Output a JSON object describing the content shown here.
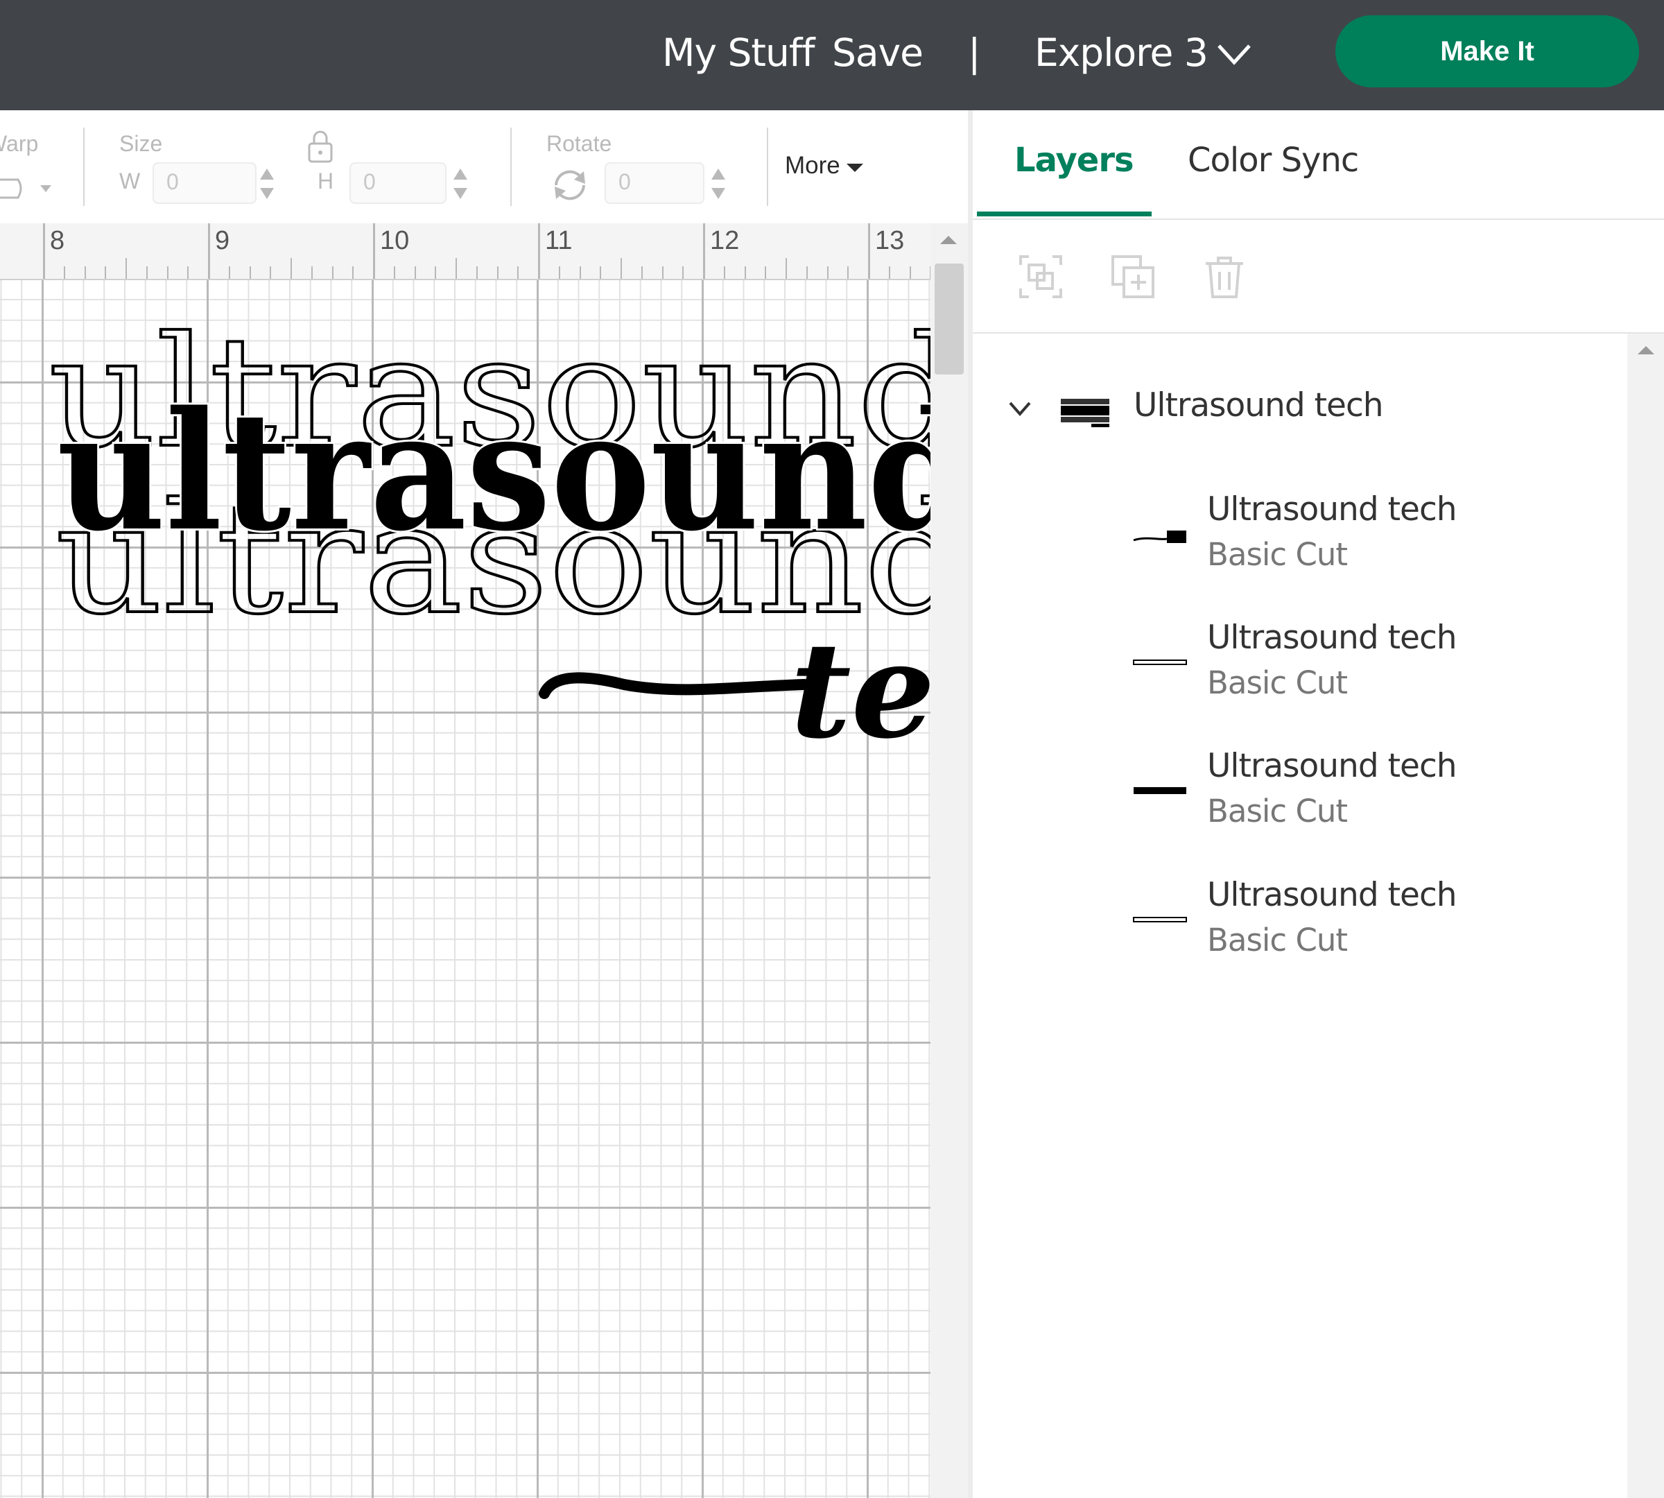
{
  "header": {
    "my_stuff": "My Stuff",
    "save": "Save",
    "separator": "|",
    "machine": "Explore 3",
    "make_it": "Make It",
    "background": "#414549",
    "accent": "#007f5b"
  },
  "toolbar": {
    "warp_label": "Warp",
    "size_label": "Size",
    "width_prefix": "W",
    "width_value": "0",
    "height_prefix": "H",
    "height_value": "0",
    "rotate_label": "Rotate",
    "rotate_value": "0",
    "more_label": "More",
    "icons": [
      "warp-icon",
      "lock-icon",
      "rotate-icon"
    ]
  },
  "ruler": {
    "ticks": [
      "8",
      "9",
      "10",
      "11",
      "12",
      "13"
    ]
  },
  "artwork": {
    "main_word": "ultrasound",
    "script_word": "tech"
  },
  "panel": {
    "tabs": [
      {
        "label": "Layers",
        "active": true
      },
      {
        "label": "Color Sync",
        "active": false
      }
    ],
    "actions": [
      "group-icon",
      "duplicate-icon",
      "delete-icon"
    ],
    "group": {
      "name": "Ultrasound tech",
      "expanded": true
    },
    "layers": [
      {
        "name": "Ultrasound tech",
        "operation": "Basic Cut"
      },
      {
        "name": "Ultrasound tech",
        "operation": "Basic Cut"
      },
      {
        "name": "Ultrasound tech",
        "operation": "Basic Cut"
      },
      {
        "name": "Ultrasound tech",
        "operation": "Basic Cut"
      }
    ]
  }
}
